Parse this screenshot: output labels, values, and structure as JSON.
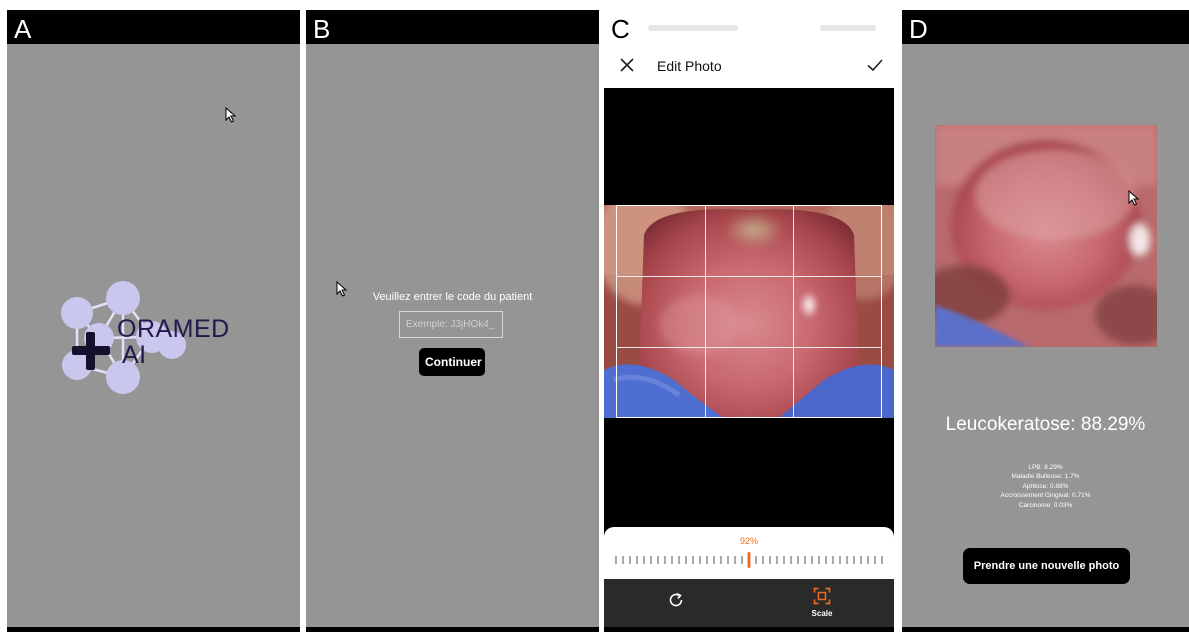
{
  "panels": {
    "a": {
      "letter": "A",
      "logo": {
        "line1": "ORAMED",
        "line2": "AI"
      }
    },
    "b": {
      "letter": "B",
      "prompt": "Veuillez entrer le code du patient",
      "input_placeholder": "Exemple: J3jHOk4_",
      "continue_label": "Continuer"
    },
    "c": {
      "letter": "C",
      "title": "Edit Photo",
      "scale_percent": "92%",
      "scale_label": "Scale"
    },
    "d": {
      "letter": "D",
      "result": "Leucokeratose: 88.29%",
      "probabilities": [
        "LPB: 8.29%",
        "Maladie Bulleuse: 1.7%",
        "Aphtose: 0.88%",
        "Accroissement Gingival: 0.71%",
        "Carcinome: 0.03%"
      ],
      "new_photo_label": "Prendre une nouvelle photo"
    }
  },
  "icons": {
    "close": "close-icon",
    "check": "check-icon",
    "rotate": "rotate-icon",
    "scale": "scale-icon",
    "cursor": "mouse-pointer-icon"
  },
  "colors": {
    "panel_bg": "#959595",
    "accent_orange": "#ef6b1e",
    "logo_node": "#c9c7ee",
    "logo_text": "#22184e"
  }
}
